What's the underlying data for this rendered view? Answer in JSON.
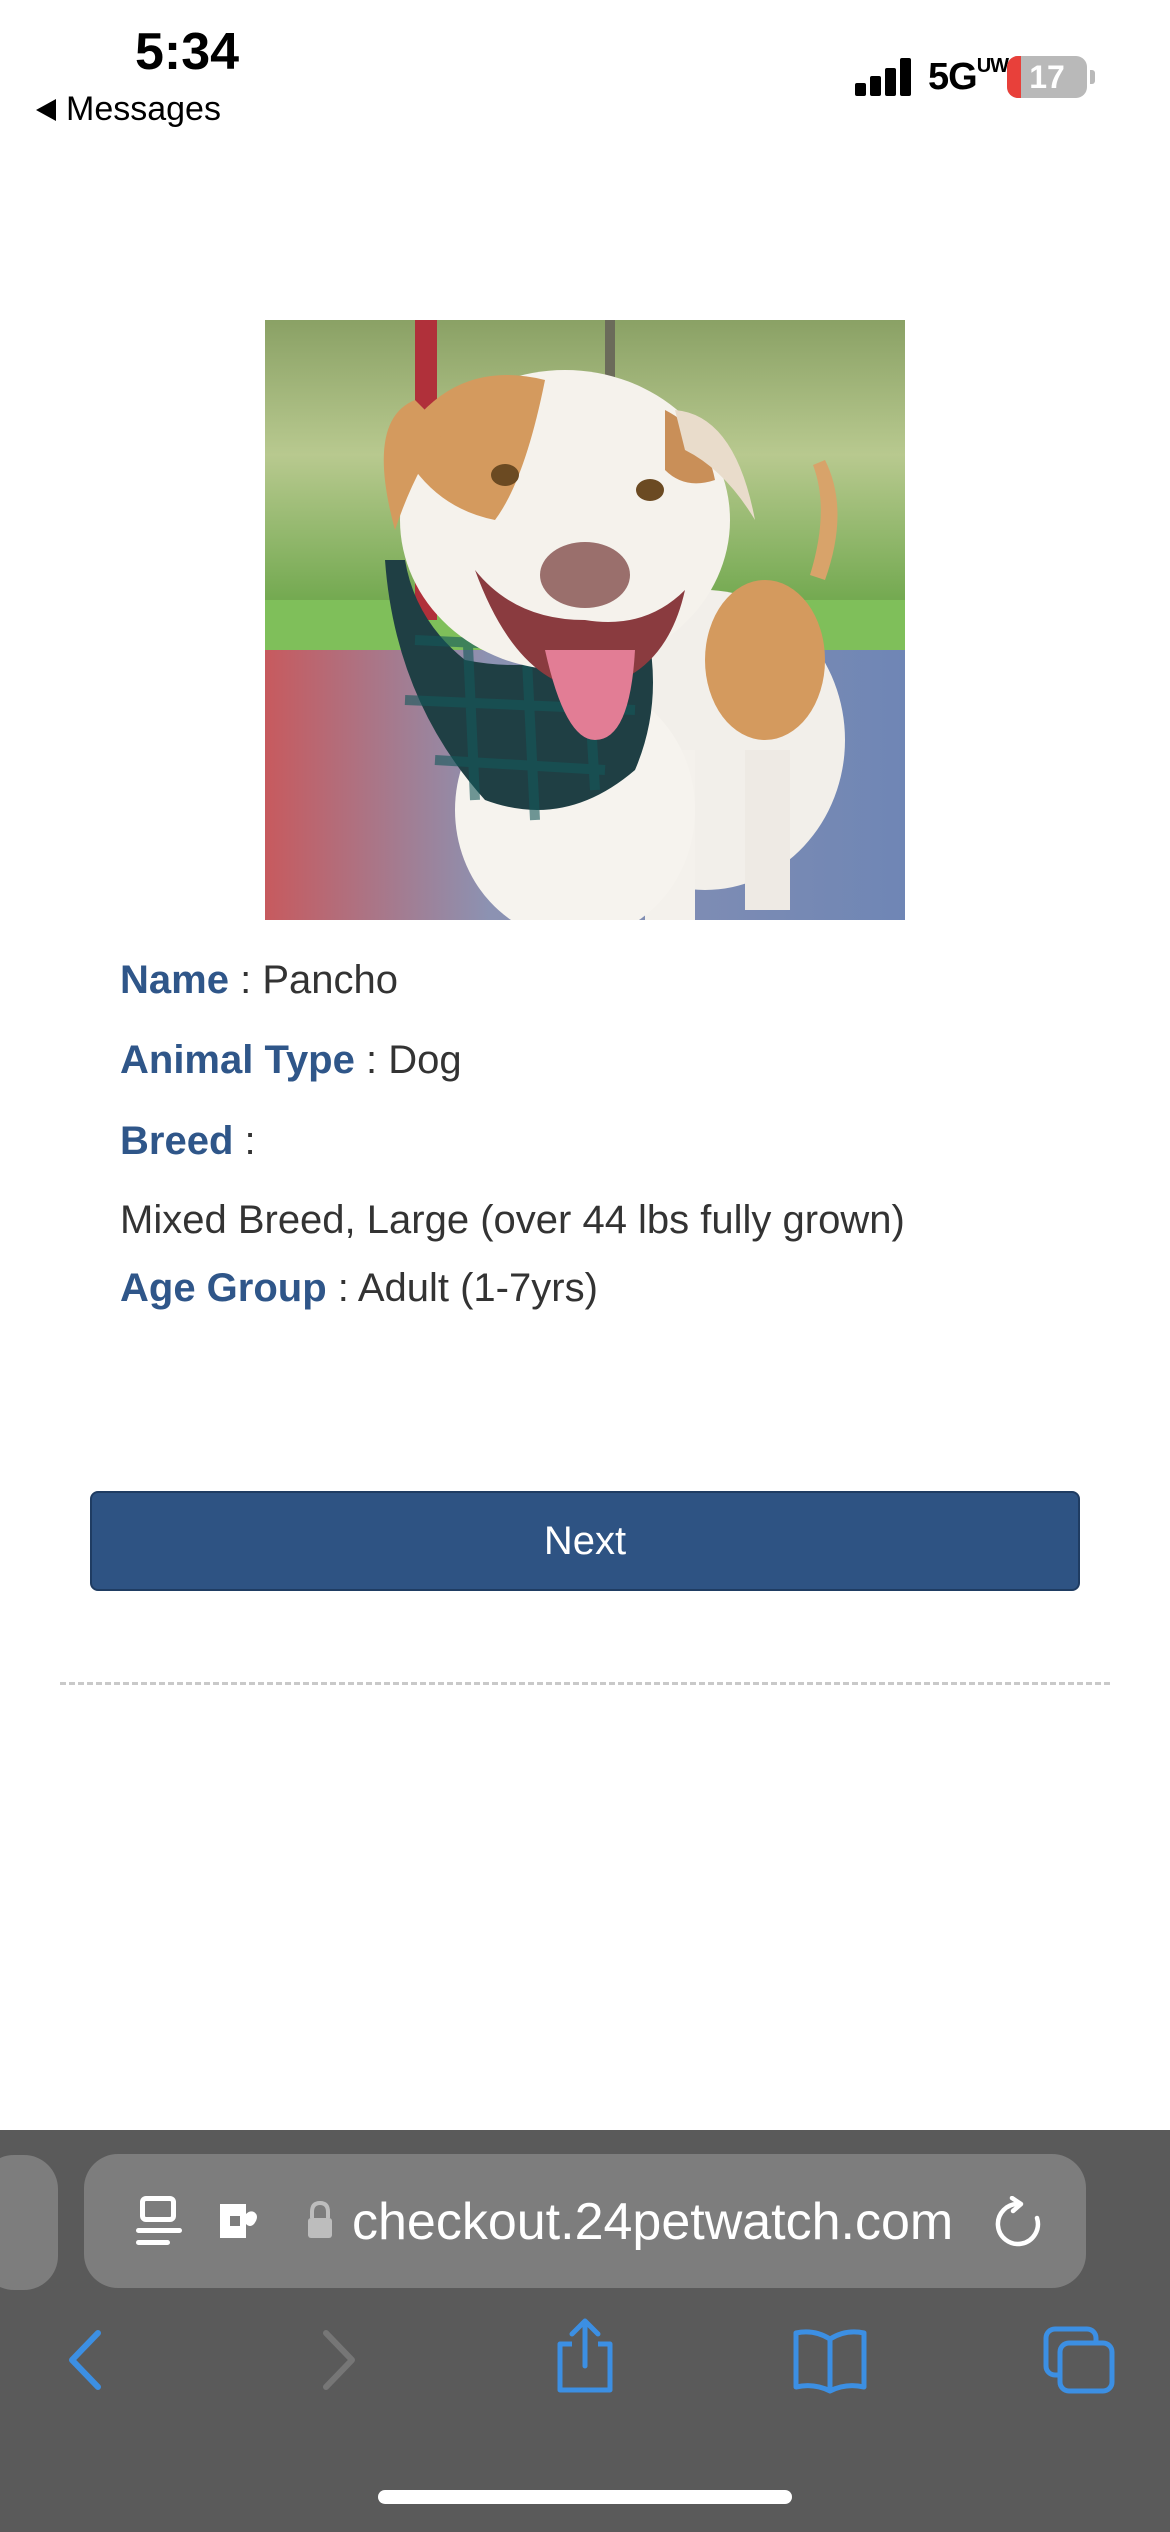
{
  "status_bar": {
    "time": "5:34",
    "back_app": "Messages",
    "network": "5G",
    "network_sup": "UW",
    "battery_level": "17",
    "battery_fraction": 0.17
  },
  "pet": {
    "photo_alt": "",
    "name_label": "Name",
    "name_value": "Pancho",
    "type_label": "Animal Type",
    "type_value": "Dog",
    "breed_label": "Breed",
    "breed_value": "Mixed Breed, Large (over 44 lbs fully grown)",
    "age_label": "Age Group",
    "age_value": "Adult (1-7yrs)",
    "separator": ":"
  },
  "actions": {
    "next_label": "Next"
  },
  "browser": {
    "url": "checkout.24petwatch.com"
  },
  "colors": {
    "label_blue": "#2f5689",
    "button_blue": "#2e5383",
    "toolbar_blue": "#3c8fe3",
    "browser_bg": "#5a5a5a"
  },
  "icons": {
    "status": [
      "signal-icon",
      "battery-icon"
    ],
    "address_bar": [
      "reader-icon",
      "extension-icon",
      "lock-icon",
      "reload-icon"
    ],
    "toolbar": [
      "back-icon",
      "forward-icon",
      "share-icon",
      "bookmarks-icon",
      "tabs-icon"
    ]
  }
}
